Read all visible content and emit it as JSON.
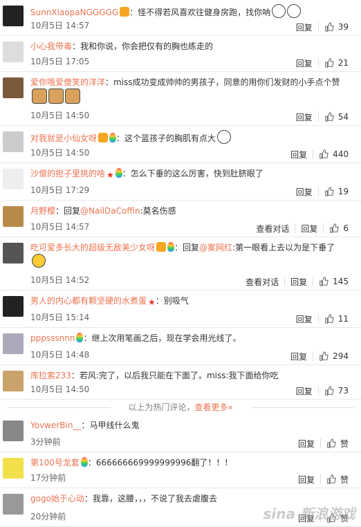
{
  "comments": [
    {
      "user": "SunnXiaopaNGGGGG",
      "sep": "：",
      "text": "怪不得若风喜欢往健身房跑，找你呐",
      "date": "10月5日 14:57",
      "reply": "回复",
      "likes": "39",
      "show_view": false,
      "avatar_color": "#222",
      "badges": [
        "vip"
      ],
      "emojis": [
        "face",
        "face"
      ]
    },
    {
      "user": "小心我带毒",
      "sep": "：",
      "text": "我和你说，你会把仅有的胸也练走的",
      "date": "10月5日 17:05",
      "reply": "回复",
      "likes": "21",
      "show_view": false,
      "avatar_color": "#ddd",
      "badges": [],
      "emojis": []
    },
    {
      "user": "爱你哦爱傻笑的洋洋",
      "sep": "：",
      "text": "miss成功变成帅帅的男孩子，同意的用你们发财的小手点个赞",
      "date": "10月5日 14:50",
      "reply": "回复",
      "likes": "54",
      "show_view": false,
      "avatar_color": "#7a5a3a",
      "badges": [],
      "emojis": [
        "dog",
        "dog",
        "dog"
      ]
    },
    {
      "user": "对我就是小仙女呀",
      "sep": "：",
      "text": "这个蓝孩子的胸肌有点大",
      "date": "10月5日 14:50",
      "reply": "回复",
      "likes": "440",
      "show_view": false,
      "avatar_color": "#ccc",
      "badges": [
        "vip",
        "balloon"
      ],
      "emojis": [
        "face"
      ]
    },
    {
      "user": "沙僧的担子里挑的啥",
      "sep": "：",
      "text": "怎么下垂的这么厉害，快到肚脐眼了",
      "date": "10月5日 17:29",
      "reply": "回复",
      "likes": "19",
      "show_view": false,
      "avatar_color": "#eee",
      "badges": [
        "star",
        "balloon"
      ],
      "emojis": []
    },
    {
      "user": "月野樱",
      "sep": "：",
      "text": "回复",
      "mention": "@NailDaCoffin",
      "text2": ":莫名伤感",
      "date": "10月5日 14:57",
      "view": "查看对话",
      "reply": "回复",
      "likes": "6",
      "show_view": true,
      "avatar_color": "#b88a4a",
      "badges": [],
      "emojis": []
    },
    {
      "user": "吃可爱多长大的超级无敌美少女呀",
      "sep": "：",
      "text": "回复",
      "mention": "@案网红",
      "text2": ":第一眼看上去以为是下垂了",
      "date": "10月5日 14:52",
      "view": "查看对话",
      "reply": "回复",
      "likes": "145",
      "show_view": true,
      "avatar_color": "#555",
      "badges": [
        "vip",
        "balloon"
      ],
      "emojis": [
        "laugh"
      ]
    },
    {
      "user": "男人的内心都有颗坚硬的水煮蛋",
      "sep": "：",
      "text": "别吸气",
      "date": "10月5日 15:14",
      "reply": "回复",
      "likes": "11",
      "show_view": false,
      "avatar_color": "#222",
      "badges": [
        "star"
      ],
      "emojis": []
    },
    {
      "user": "pppsssnnn",
      "sep": "：",
      "text": "继上次用笔画之后，现在学会用光线了。",
      "date": "10月5日 14:48",
      "reply": "回复",
      "likes": "294",
      "show_view": false,
      "avatar_color": "#aab",
      "badges": [
        "balloon"
      ],
      "emojis": []
    },
    {
      "user": "库拉索233",
      "sep": "：",
      "text": "若风:完了，以后我只能在下面了。miss:我下面给你吃",
      "date": "10月5日 14:50",
      "reply": "回复",
      "likes": "73",
      "show_view": false,
      "avatar_color": "#c9a36b",
      "badges": [],
      "emojis": []
    },
    {
      "user": "YovwerBin__",
      "sep": "：",
      "text": "马甲线什么鬼",
      "date": "3分钟前",
      "reply": "回复",
      "likes": "赞",
      "show_view": false,
      "avatar_color": "#888",
      "badges": [],
      "emojis": []
    },
    {
      "user": "第100号龙套",
      "sep": "：",
      "text": "666666669999999996翻了！！！",
      "date": "17分钟前",
      "reply": "回复",
      "likes": "赞",
      "show_view": false,
      "avatar_color": "#f2e04a",
      "badges": [
        "balloon"
      ],
      "emojis": []
    },
    {
      "user": "gogo始于心动",
      "sep": "：",
      "text": "我靠，这腰，，，不说了我去虐腹去",
      "date": "20分钟前",
      "reply": "回复",
      "likes": "赞",
      "show_view": false,
      "avatar_color": "#999",
      "badges": [],
      "emojis": []
    }
  ],
  "divider": {
    "text": "以上为热门评论，",
    "link": "查看更多»"
  },
  "watermark": "sina 新浪游戏"
}
